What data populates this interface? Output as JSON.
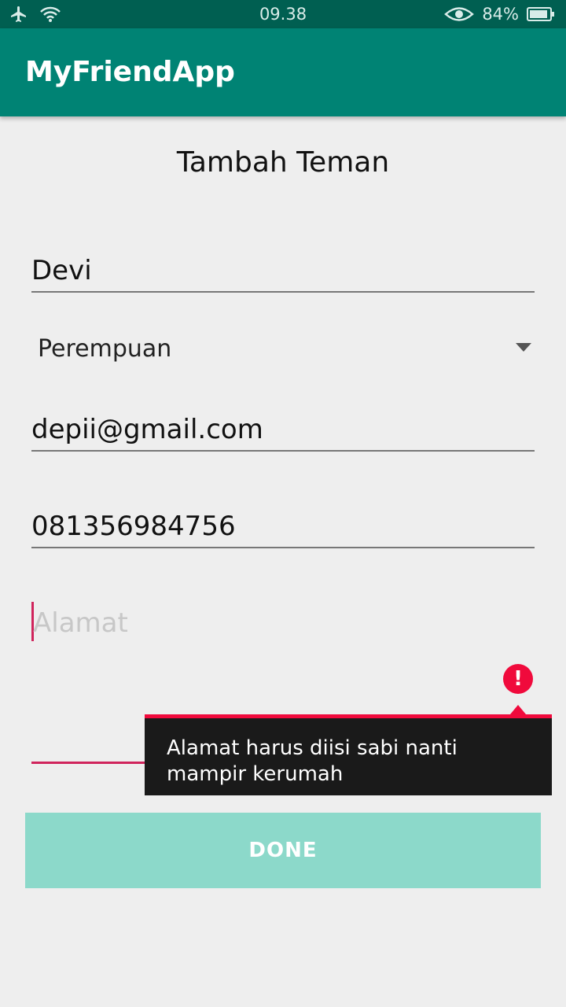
{
  "status_bar": {
    "time": "09.38",
    "battery": "84%",
    "icons": [
      "airplane-icon",
      "wifi-icon",
      "eye-icon",
      "battery-icon"
    ]
  },
  "app_bar": {
    "title": "MyFriendApp"
  },
  "form": {
    "title": "Tambah Teman",
    "name_value": "Devi",
    "gender_value": "Perempuan",
    "email_value": "depii@gmail.com",
    "phone_value": "081356984756",
    "address_placeholder": "Alamat",
    "address_error": "Alamat harus diisi sabi nanti mampir kerumah",
    "done_label": "DONE"
  },
  "colors": {
    "status_bar": "#005f51",
    "app_bar": "#008374",
    "accent": "#d0245c",
    "error": "#f00a3c",
    "button": "#8cd9ca"
  }
}
